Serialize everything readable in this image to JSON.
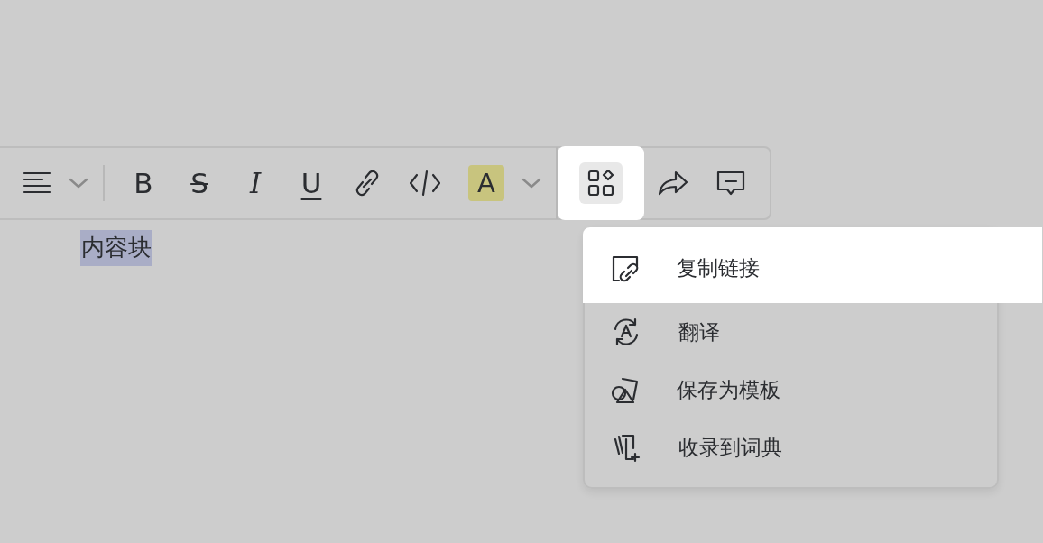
{
  "toolbar": {
    "items": [
      {
        "kind": "align",
        "highlighted": false
      },
      {
        "kind": "caret",
        "highlighted": false
      },
      {
        "kind": "divider"
      },
      {
        "kind": "bold",
        "label": "B",
        "highlighted": false
      },
      {
        "kind": "strike",
        "label": "S",
        "highlighted": false
      },
      {
        "kind": "italic",
        "label": "I",
        "highlighted": false
      },
      {
        "kind": "underline",
        "label": "U",
        "highlighted": false
      },
      {
        "kind": "link",
        "highlighted": false
      },
      {
        "kind": "code",
        "highlighted": false
      },
      {
        "kind": "color",
        "label": "A",
        "color": "#c8c47e",
        "highlighted": false
      },
      {
        "kind": "caret",
        "highlighted": false
      },
      {
        "kind": "divider"
      },
      {
        "kind": "apps",
        "highlighted": true
      },
      {
        "kind": "share",
        "highlighted": false
      },
      {
        "kind": "comment",
        "highlighted": false
      }
    ]
  },
  "selected_text": "内容块",
  "menu": {
    "items": [
      {
        "kind": "copy-link",
        "label": "复制链接",
        "highlighted": true
      },
      {
        "kind": "translate",
        "label": "翻译",
        "highlighted": false
      },
      {
        "kind": "template",
        "label": "保存为模板",
        "highlighted": false
      },
      {
        "kind": "dictionary",
        "label": "收录到词典",
        "highlighted": false
      }
    ]
  }
}
